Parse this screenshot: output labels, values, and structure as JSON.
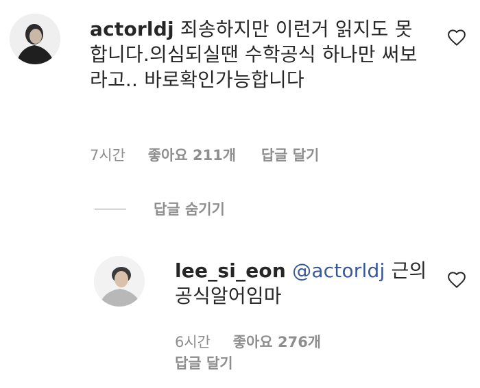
{
  "comment": {
    "username": "actorldj",
    "text": "죄송하지만 이런거 읽지도 못합니다.의심되실땐 수학공식 하나만 써보라고.. 바로확인가능합니다",
    "time": "7시간",
    "likes": "좋아요 211개",
    "reply_label": "답글 달기"
  },
  "hide_replies_label": "답글 숨기기",
  "reply": {
    "username": "lee_si_eon",
    "mention": "@actorldj",
    "text": "근의 공식알어임마",
    "time": "6시간",
    "likes": "좋아요 276개",
    "reply_label": "답글 달기"
  },
  "colors": {
    "text": "#262626",
    "muted": "#8e8e8e",
    "mention": "#385898"
  },
  "icons": {
    "like": "heart-outline-icon"
  }
}
